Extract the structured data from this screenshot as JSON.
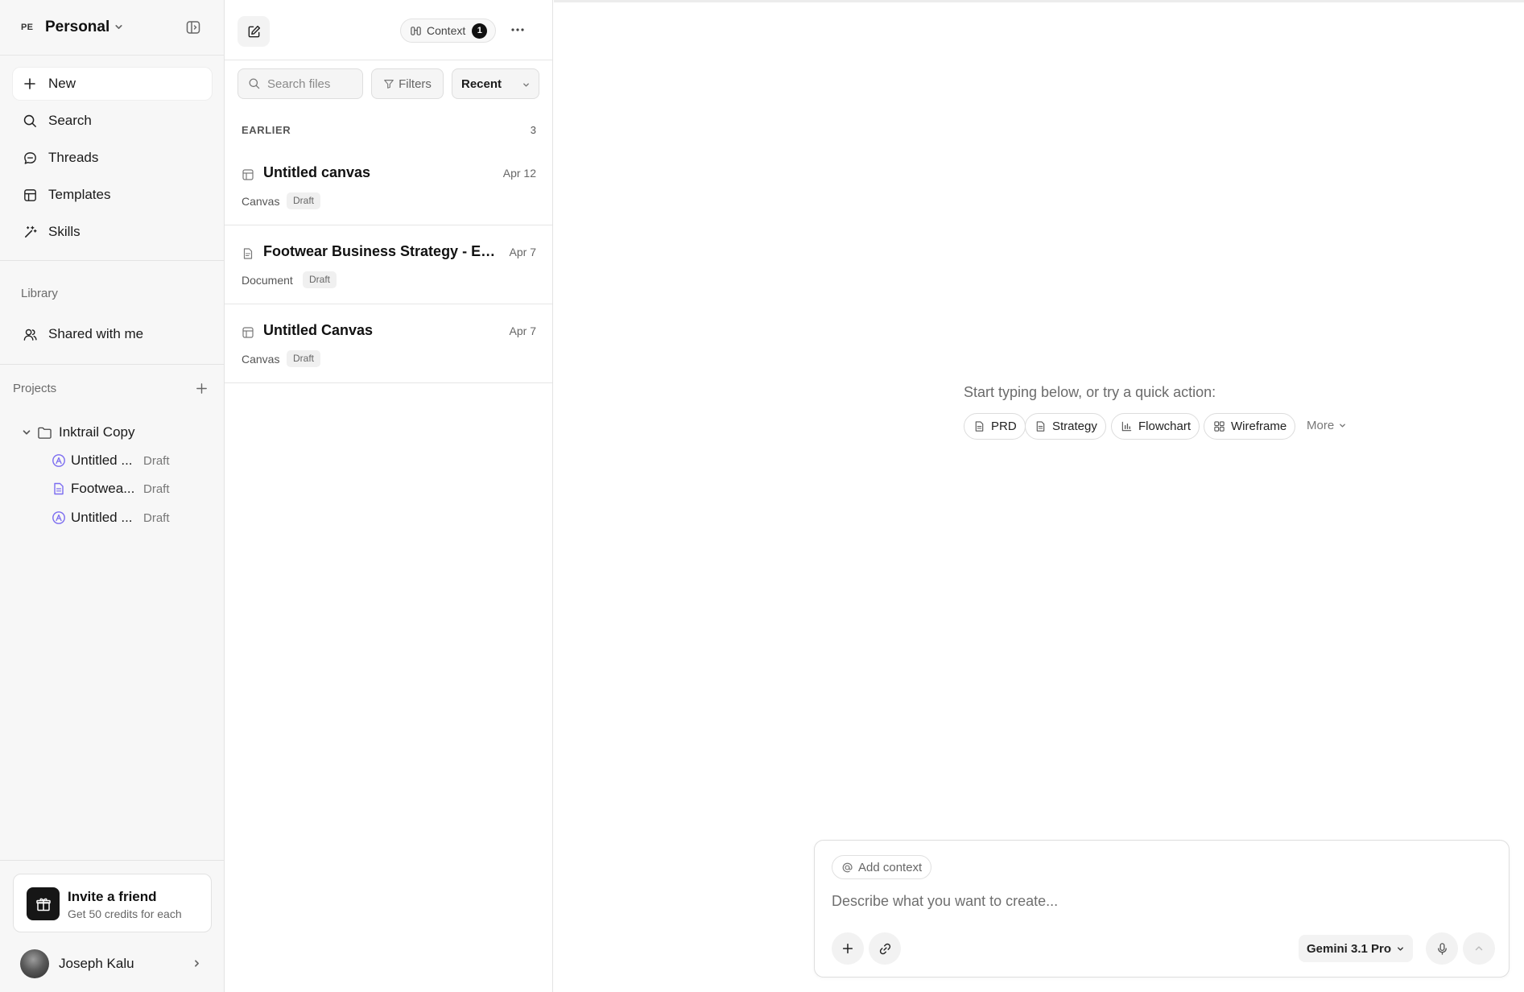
{
  "sidebar": {
    "workspace_badge": "PE",
    "workspace_name": "Personal",
    "nav": [
      {
        "label": "New",
        "icon": "plus-icon"
      },
      {
        "label": "Search",
        "icon": "search-icon"
      },
      {
        "label": "Threads",
        "icon": "chat-bubble-icon"
      },
      {
        "label": "Templates",
        "icon": "template-icon"
      },
      {
        "label": "Skills",
        "icon": "magic-wand-icon"
      }
    ],
    "library_label": "Library",
    "shared_label": "Shared with me",
    "projects_label": "Projects",
    "project": {
      "name": "Inktrail Copy",
      "items": [
        {
          "label": "Untitled ...",
          "status": "Draft",
          "icon": "canvas-icon"
        },
        {
          "label": "Footwea...",
          "status": "Draft",
          "icon": "document-icon"
        },
        {
          "label": "Untitled ...",
          "status": "Draft",
          "icon": "canvas-icon"
        }
      ]
    },
    "invite": {
      "title": "Invite a friend",
      "subtitle": "Get 50 credits for each"
    },
    "user": {
      "name": "Joseph Kalu"
    }
  },
  "filepanel": {
    "context_label": "Context",
    "context_count": "1",
    "search_placeholder": "Search files",
    "filters_label": "Filters",
    "sort_label": "Recent",
    "group": {
      "label": "EARLIER",
      "count": "3"
    },
    "files": [
      {
        "title": "Untitled canvas",
        "date": "Apr 12",
        "kind": "Canvas",
        "status": "Draft"
      },
      {
        "title": "Footwear Business Strategy - Est...",
        "date": "Apr 7",
        "kind": "Document",
        "status": "Draft"
      },
      {
        "title": "Untitled Canvas",
        "date": "Apr 7",
        "kind": "Canvas",
        "status": "Draft"
      }
    ]
  },
  "main": {
    "prompt": "Start typing below, or try a quick action:",
    "quick_actions": [
      {
        "label": "PRD",
        "icon": "document-icon"
      },
      {
        "label": "Strategy",
        "icon": "document-icon"
      },
      {
        "label": "Flowchart",
        "icon": "bar-chart-icon"
      },
      {
        "label": "Wireframe",
        "icon": "grid-icon"
      }
    ],
    "more_label": "More",
    "composer": {
      "add_context_label": "Add context",
      "placeholder": "Describe what you want to create...",
      "model": "Gemini 3.1 Pro"
    }
  }
}
